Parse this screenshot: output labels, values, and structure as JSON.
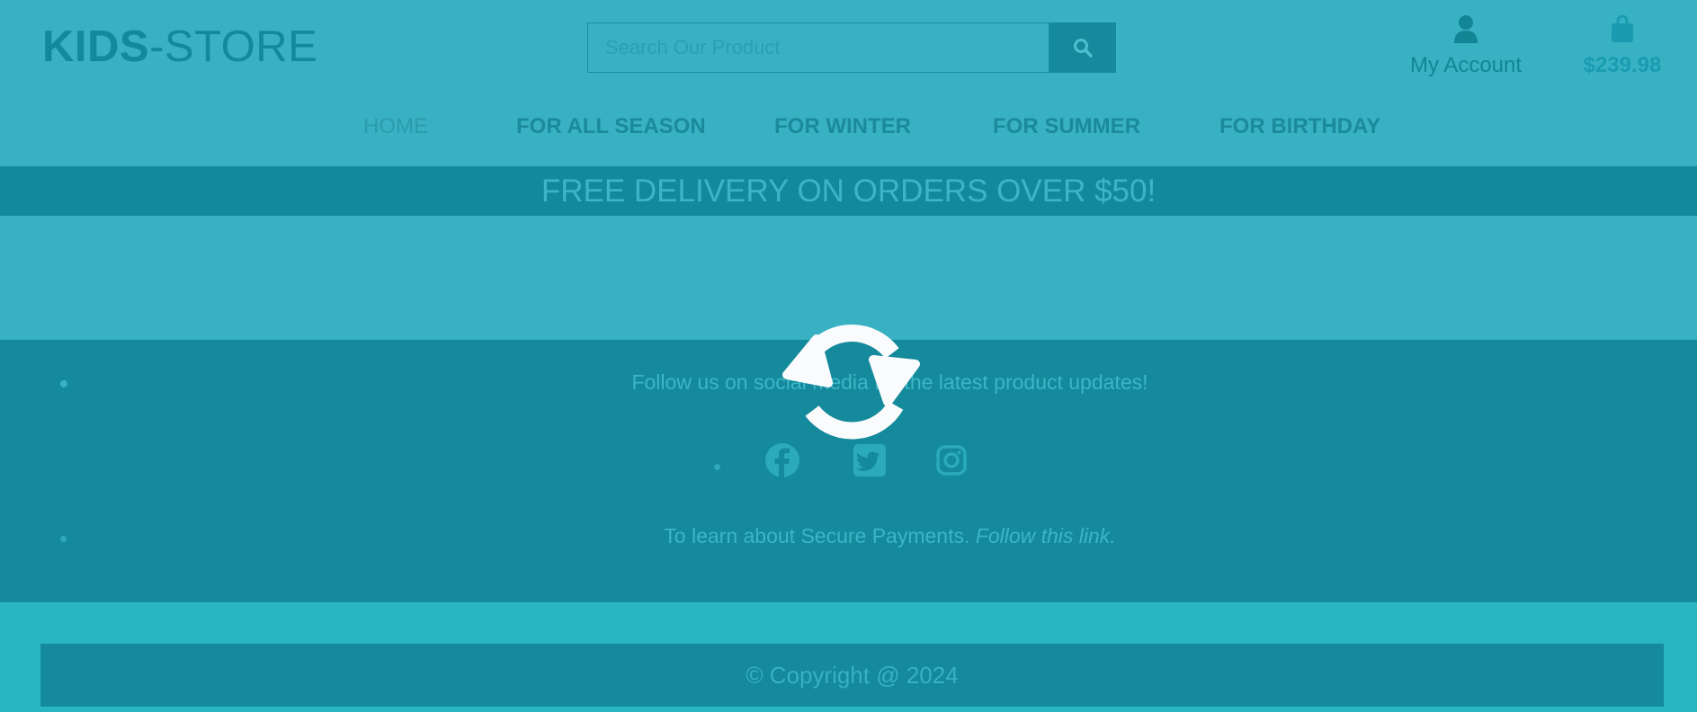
{
  "brand": {
    "bold": "KIDS",
    "rest": "-STORE"
  },
  "search": {
    "placeholder": "Search Our Product",
    "button_icon": "search-icon"
  },
  "account": {
    "label": "My Account",
    "icon": "user-icon"
  },
  "cart": {
    "total": "$239.98",
    "icon": "shopping-bag-icon"
  },
  "nav": {
    "items": [
      "HOME",
      "FOR ALL SEASON",
      "FOR WINTER",
      "FOR SUMMER",
      "FOR BIRTHDAY"
    ],
    "active": "HOME"
  },
  "banner": {
    "text": "FREE DELIVERY ON ORDERS OVER $50!"
  },
  "social": {
    "follow_text": "Follow us on social media for the latest product updates!",
    "icons": [
      "facebook-icon",
      "twitter-icon",
      "instagram-icon"
    ]
  },
  "payments": {
    "text": "To learn about Secure Payments.",
    "link": "Follow this link."
  },
  "footer": {
    "copyright": "© Copyright @ 2024"
  },
  "overlay": {
    "icon": "refresh-icon"
  },
  "colors": {
    "header_bg": "#38b1c3",
    "banner_bg": "#138a9c",
    "accent": "#158a9c",
    "page_bg": "#2ab5c2"
  }
}
